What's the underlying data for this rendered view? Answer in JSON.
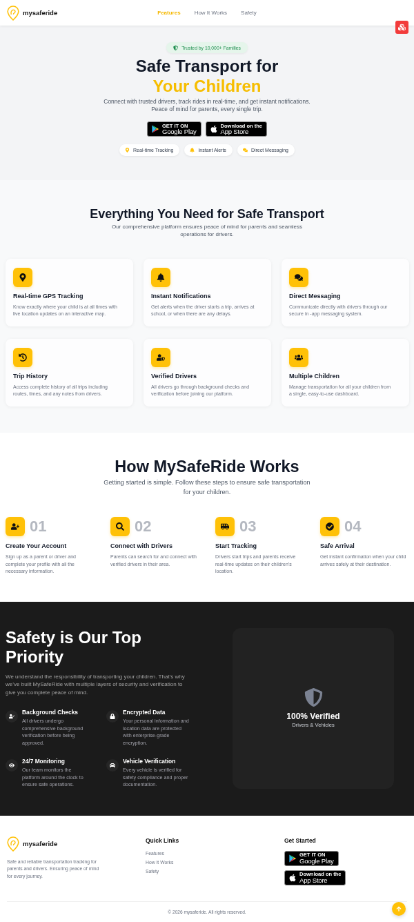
{
  "header": {
    "brand": "mysaferide",
    "nav": [
      {
        "label": "Features",
        "selected": true
      },
      {
        "label": "How It Works",
        "selected": false
      },
      {
        "label": "Safety",
        "selected": false
      }
    ]
  },
  "hero": {
    "badge": "Trusted by 10,000+ Families",
    "title": "Safe Transport for",
    "title_highlight": "Your Children",
    "description": "Connect with trusted drivers, track rides in real-time, and get instant notifications. Peace of mind for parents, every single trip.",
    "store_buttons": [
      {
        "caption": "GET IT ON",
        "label": "Google Play"
      },
      {
        "caption": "Download on the",
        "label": "App Store"
      }
    ],
    "chips": [
      "Real-time Tracking",
      "Instant Alerts",
      "Direct Messaging"
    ]
  },
  "features": {
    "title": "Everything You Need for Safe Transport",
    "subtitle": "Our comprehensive platform ensures peace of mind for parents and seamless operations for drivers.",
    "cards": [
      {
        "title": "Real-time GPS Tracking",
        "description": "Know exactly where your child is at all times with live location updates on an interactive map."
      },
      {
        "title": "Instant Notifications",
        "description": "Get alerts when the driver starts a trip, arrives at school, or when there are any delays."
      },
      {
        "title": "Direct Messaging",
        "description": "Communicate directly with drivers through our secure in -app messaging system."
      },
      {
        "title": "Trip History",
        "description": "Access complete history of all trips including routes, times, and any notes from drivers."
      },
      {
        "title": "Verified Drivers",
        "description": "All drivers go through background checks and verification before joining our platform."
      },
      {
        "title": "Multiple Children",
        "description": "Manage transportation for all your children from a single, easy-to-use dashboard."
      }
    ]
  },
  "how_it_works": {
    "title": "How MySafeRide Works",
    "subtitle": "Getting started is simple. Follow these steps to ensure safe transportation for your children.",
    "steps": [
      {
        "number": "01",
        "title": "Create Your Account",
        "description": "Sign up as a parent or driver and complete your profile with all the necessary information."
      },
      {
        "number": "02",
        "title": "Connect with Drivers",
        "description": "Parents can search for and connect with verified drivers in their area."
      },
      {
        "number": "03",
        "title": "Start Tracking",
        "description": "Drivers start trips and parents receive real-time updates on their children’s location."
      },
      {
        "number": "04",
        "title": "Safe Arrival",
        "description": "Get instant confirmation when your child arrives safely at their destination."
      }
    ]
  },
  "safety": {
    "title": "Safety is Our Top Priority",
    "description": "We understand the responsibility of transporting your children. That’s why we’ve built MySafeRide with multiple layers of security and verification to give you complete peace of mind.",
    "items": [
      {
        "title": "Background Checks",
        "description": "All drivers undergo comprehensive background verification before being approved."
      },
      {
        "title": "Encrypted Data",
        "description": "Your personal information and location data are protected with enterprise-grade encryption."
      },
      {
        "title": "24/7 Monitoring",
        "description": "Our team monitors the platform around the clock to ensure safe operations."
      },
      {
        "title": "Vehicle Verification",
        "description": "Every vehicle is verified for safety compliance and proper documentation."
      }
    ],
    "verified_card": {
      "title": "100% Verified",
      "subtitle": "Drivers & Vehicles"
    }
  },
  "footer": {
    "brand": "mysaferide",
    "description": "Safe and reliable transportation tracking for parents and drivers. Ensuring peace of mind for every journey.",
    "quick_links": {
      "title": "Quick Links",
      "links": [
        "Features",
        "How It Works",
        "Safety"
      ]
    },
    "get_started": {
      "title": "Get Started",
      "store_buttons": [
        {
          "caption": "GET IT ON",
          "label": "Google Play"
        },
        {
          "caption": "Download on the",
          "label": "App Store"
        }
      ]
    },
    "copyright": "© 2026 mysaferide. All rights reserved."
  }
}
